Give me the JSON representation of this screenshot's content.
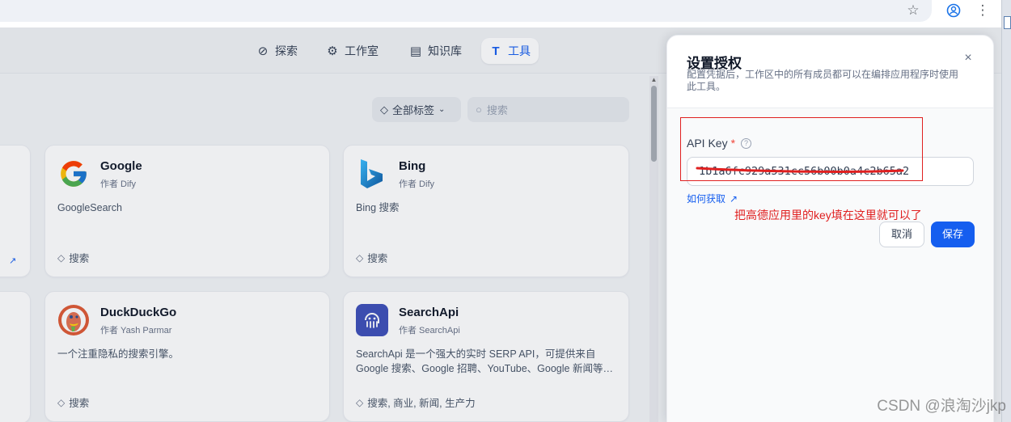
{
  "browser": {
    "icons": [
      "star-icon",
      "account-icon",
      "more-icon"
    ]
  },
  "nav": {
    "items": [
      {
        "label": "探索",
        "icon": "compass-icon",
        "active": false
      },
      {
        "label": "工作室",
        "icon": "robot-icon",
        "active": false
      },
      {
        "label": "知识库",
        "icon": "book-icon",
        "active": false
      },
      {
        "label": "工具",
        "icon": "tools-icon",
        "active": true
      }
    ]
  },
  "filters": {
    "tag_label": "全部标签",
    "search_placeholder": "搜索"
  },
  "cards": [
    {
      "name": "Google",
      "author": "作者 Dify",
      "description": "GoogleSearch",
      "tags": "搜索",
      "logo": "google-logo"
    },
    {
      "name": "Bing",
      "author": "作者 Dify",
      "description": "Bing 搜索",
      "tags": "搜索",
      "logo": "bing-logo"
    },
    {
      "name": "DuckDuckGo",
      "author": "作者 Yash Parmar",
      "description": "一个注重隐私的搜索引擎。",
      "tags": "搜索",
      "logo": "duckduckgo-logo"
    },
    {
      "name": "SearchApi",
      "author": "作者 SearchApi",
      "description": "SearchApi 是一个强大的实时 SERP API，可提供来自 Google 搜索、Google 招聘、YouTube、Google 新闻等…",
      "tags": "搜索, 商业, 新闻, 生产力",
      "logo": "searchapi-logo"
    }
  ],
  "drawer": {
    "title": "设置授权",
    "subtitle": "配置凭据后，工作区中的所有成员都可以在编排应用程序时使用此工具。",
    "field_label": "API Key",
    "required_mark": "*",
    "api_key_value": "1b1a6fc929a531cc56b00b0a4c2b65a2",
    "howto_label": "如何获取",
    "cancel_label": "取消",
    "save_label": "保存"
  },
  "annotation": {
    "note": "把高德应用里的key填在这里就可以了",
    "color": "#e02020"
  },
  "watermark": "CSDN @浪淘沙jkp",
  "colors": {
    "accent": "#155eef",
    "annotation_red": "#e02020"
  }
}
